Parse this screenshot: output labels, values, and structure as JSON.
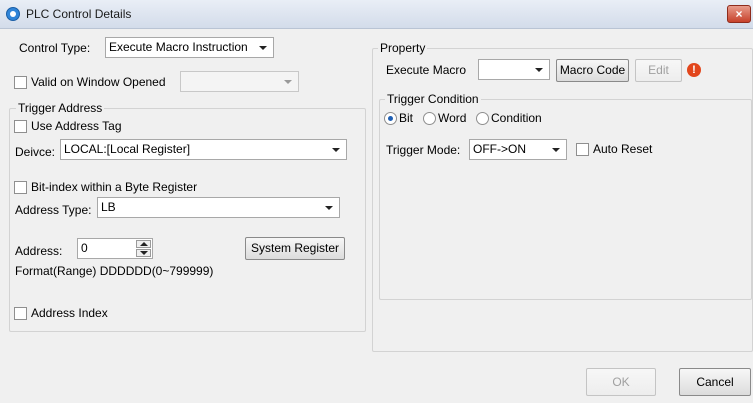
{
  "window": {
    "title": "PLC Control Details",
    "close_label": "×"
  },
  "control_type": {
    "label": "Control Type:",
    "value": "Execute Macro Instruction"
  },
  "valid_on_window_opened": {
    "label": "Valid on Window Opened",
    "checked": false,
    "value": ""
  },
  "trigger_address": {
    "legend": "Trigger Address",
    "use_address_tag": "Use Address Tag",
    "device_label": "Deivce:",
    "device_value": "LOCAL:[Local Register]",
    "bit_index_label": "Bit-index within a Byte Register",
    "address_type_label": "Address Type:",
    "address_type_value": "LB",
    "address_label": "Address:",
    "address_value": "0",
    "system_register_label": "System Register",
    "format_text": "Format(Range) DDDDDD(0~799999)",
    "address_index_label": "Address Index"
  },
  "property": {
    "legend": "Property",
    "execute_macro_label": "Execute Macro",
    "execute_macro_value": "",
    "macro_code_label": "Macro Code",
    "edit_label": "Edit",
    "warning_glyph": "!"
  },
  "trigger_condition": {
    "legend": "Trigger Condition",
    "options": [
      "Bit",
      "Word",
      "Condition"
    ],
    "selected": "Bit",
    "trigger_mode_label": "Trigger Mode:",
    "trigger_mode_value": "OFF->ON",
    "auto_reset_label": "Auto Reset"
  },
  "footer": {
    "ok_label": "OK",
    "cancel_label": "Cancel"
  },
  "colors": {
    "accent": "#1e5fb4",
    "warning": "#e2461c",
    "close": "#c7412a"
  }
}
